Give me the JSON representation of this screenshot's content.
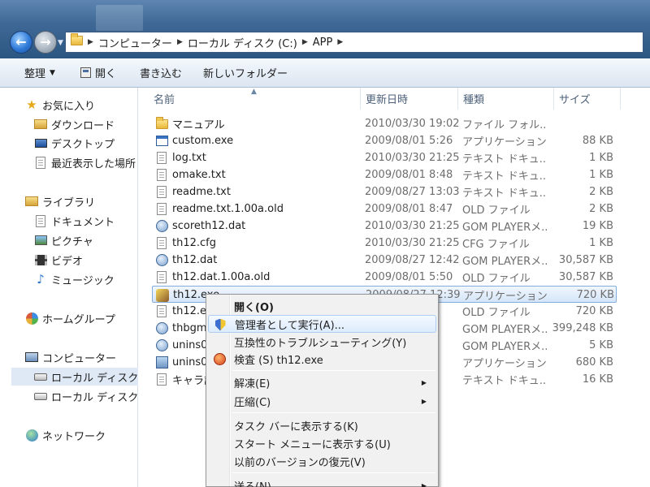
{
  "address": {
    "crumbs": [
      "コンピューター",
      "ローカル ディスク (C:)",
      "APP"
    ]
  },
  "toolbar": {
    "organize": "整理",
    "open": "開く",
    "write": "書き込む",
    "new_folder": "新しいフォルダー"
  },
  "nav": {
    "favorites": "お気に入り",
    "downloads": "ダウンロード",
    "desktop": "デスクトップ",
    "recent": "最近表示した場所",
    "libraries": "ライブラリ",
    "documents": "ドキュメント",
    "pictures": "ピクチャ",
    "videos": "ビデオ",
    "music": "ミュージック",
    "homegroup": "ホームグループ",
    "computer": "コンピューター",
    "local_disk_1": "ローカル ディスク (",
    "local_disk_2": "ローカル ディスク (",
    "network": "ネットワーク"
  },
  "columns": {
    "name": "名前",
    "date": "更新日時",
    "type": "種類",
    "size": "サイズ"
  },
  "files": [
    {
      "name": "マニュアル",
      "date": "2010/03/30 19:02",
      "type": "ファイル フォル...",
      "size": "",
      "icon": "folder-icon"
    },
    {
      "name": "custom.exe",
      "date": "2009/08/01 5:26",
      "type": "アプリケーション",
      "size": "88 KB",
      "icon": "application-icon"
    },
    {
      "name": "log.txt",
      "date": "2010/03/30 21:25",
      "type": "テキスト ドキュ...",
      "size": "1 KB",
      "icon": "text-document-icon"
    },
    {
      "name": "omake.txt",
      "date": "2009/08/01 8:48",
      "type": "テキスト ドキュ...",
      "size": "1 KB",
      "icon": "text-document-icon"
    },
    {
      "name": "readme.txt",
      "date": "2009/08/27 13:03",
      "type": "テキスト ドキュ...",
      "size": "2 KB",
      "icon": "text-document-icon"
    },
    {
      "name": "readme.txt.1.00a.old",
      "date": "2009/08/01 8:47",
      "type": "OLD ファイル",
      "size": "2 KB",
      "icon": "document-icon"
    },
    {
      "name": "scoreth12.dat",
      "date": "2010/03/30 21:25",
      "type": "GOM PLAYERメ...",
      "size": "19 KB",
      "icon": "dat-file-icon"
    },
    {
      "name": "th12.cfg",
      "date": "2010/03/30 21:25",
      "type": "CFG ファイル",
      "size": "1 KB",
      "icon": "document-icon"
    },
    {
      "name": "th12.dat",
      "date": "2009/08/27 12:42",
      "type": "GOM PLAYERメ...",
      "size": "30,587 KB",
      "icon": "dat-file-icon"
    },
    {
      "name": "th12.dat.1.00a.old",
      "date": "2009/08/01 5:50",
      "type": "OLD ファイル",
      "size": "30,587 KB",
      "icon": "document-icon"
    },
    {
      "name": "th12.exe",
      "date": "2009/08/27 12:39",
      "type": "アプリケーション",
      "size": "720 KB",
      "icon": "game-exe-icon"
    },
    {
      "name": "th12.ex",
      "date": "3",
      "type": "OLD ファイル",
      "size": "720 KB",
      "icon": "document-icon"
    },
    {
      "name": "thbgm.",
      "date": "06",
      "type": "GOM PLAYERメ...",
      "size": "399,248 KB",
      "icon": "dat-file-icon"
    },
    {
      "name": "unins00",
      "date": "02",
      "type": "GOM PLAYERメ...",
      "size": "5 KB",
      "icon": "dat-file-icon"
    },
    {
      "name": "unins00",
      "date": "01",
      "type": "アプリケーション",
      "size": "680 KB",
      "icon": "installer-icon"
    },
    {
      "name": "キャラ設",
      "date": "7",
      "type": "テキスト ドキュ...",
      "size": "16 KB",
      "icon": "text-document-icon"
    }
  ],
  "context_menu": {
    "open": "開く(O)",
    "run_as_admin": "管理者として実行(A)...",
    "troubleshoot": "互換性のトラブルシューティング(Y)",
    "scan": "検査 (S) th12.exe",
    "extract": "解凍(E)",
    "compress": "圧縮(C)",
    "pin_taskbar": "タスク バーに表示する(K)",
    "pin_start": "スタート メニューに表示する(U)",
    "restore_prev": "以前のバージョンの復元(V)",
    "send_to": "送る(N)"
  }
}
